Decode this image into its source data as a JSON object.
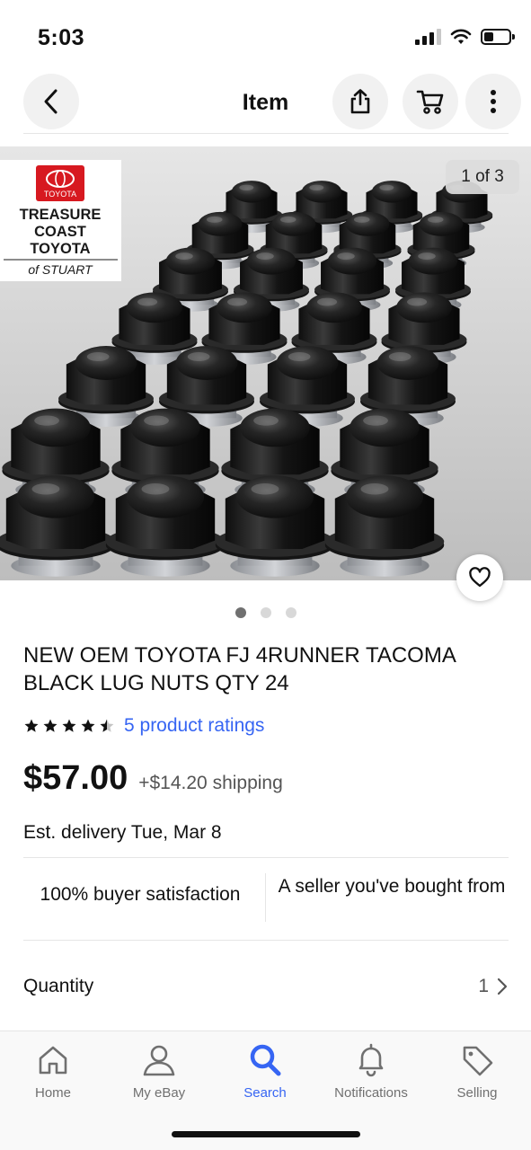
{
  "status_bar": {
    "time": "5:03",
    "battery_level": 0.4
  },
  "header": {
    "title": "Item",
    "icons": [
      "chevron-left-icon",
      "share-icon",
      "cart-icon",
      "more-vertical-icon"
    ]
  },
  "image": {
    "counter": "1 of 3",
    "current_index": 1,
    "total": 3,
    "dealer_logo": {
      "brand": "TOYOTA",
      "line1": "TREASURE",
      "line2": "COAST",
      "line3": "TOYOTA",
      "line4": "of STUART"
    }
  },
  "listing": {
    "title": "NEW OEM TOYOTA FJ 4RUNNER TACOMA BLACK LUG NUTS QTY 24",
    "rating": 4.5,
    "ratings_text": "5 product ratings",
    "price": "$57.00",
    "shipping": "+$14.20 shipping",
    "delivery": "Est. delivery Tue, Mar 8",
    "trust_left": "100% buyer satisfaction",
    "trust_right": "A seller you've bought from",
    "quantity_label": "Quantity",
    "quantity_value": "1"
  },
  "tabbar": {
    "items": [
      {
        "label": "Home",
        "icon": "home-icon"
      },
      {
        "label": "My eBay",
        "icon": "user-icon"
      },
      {
        "label": "Search",
        "icon": "search-icon",
        "active": true
      },
      {
        "label": "Notifications",
        "icon": "bell-icon"
      },
      {
        "label": "Selling",
        "icon": "tag-icon"
      }
    ]
  },
  "colors": {
    "accent": "#3665f3",
    "text": "#111111",
    "muted": "#707070",
    "divider": "#e5e5e5"
  }
}
